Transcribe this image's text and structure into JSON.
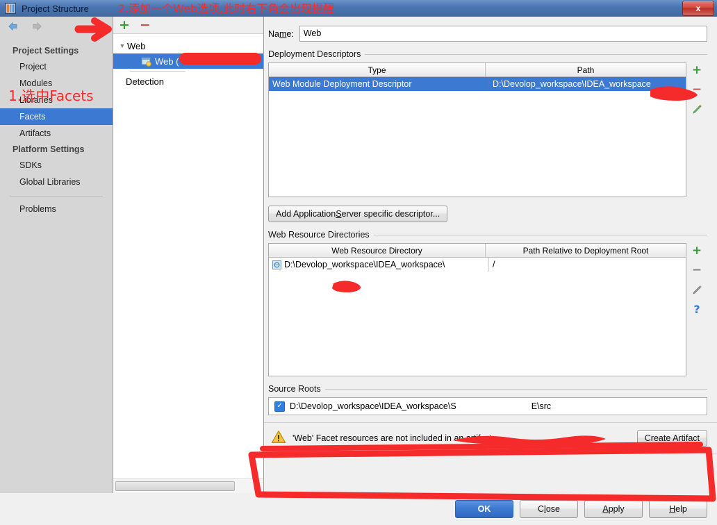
{
  "window": {
    "title": "Project Structure",
    "app_icon": "intellij-idea-icon",
    "close_label": "x"
  },
  "annotations": {
    "title_note": "2.添加一个Web选项,此时右下角会出现提醒",
    "facets_note": "1.选中Facets",
    "color": "#f52a2a"
  },
  "sidebar": {
    "nav": {
      "back_icon": "arrow-left-icon",
      "forward_icon": "arrow-right-icon"
    },
    "groups": [
      {
        "label": "Project Settings",
        "items": [
          {
            "label": "Project",
            "selected": false
          },
          {
            "label": "Modules",
            "selected": false
          },
          {
            "label": "Libraries",
            "selected": false
          },
          {
            "label": "Facets",
            "selected": true
          },
          {
            "label": "Artifacts",
            "selected": false
          }
        ]
      },
      {
        "label": "Platform Settings",
        "items": [
          {
            "label": "SDKs",
            "selected": false
          },
          {
            "label": "Global Libraries",
            "selected": false
          }
        ]
      }
    ],
    "problems_label": "Problems"
  },
  "tree": {
    "toolbar": {
      "add_label": "+",
      "remove_label": "−"
    },
    "root_label": "Web",
    "child_label": "Web (",
    "child_icon": "web-facet-icon",
    "detection_label": "Detection"
  },
  "main": {
    "name_label_pre": "Na",
    "name_label_mnemonic": "m",
    "name_label_post": "e:",
    "name_value": "Web",
    "name_placeholder": "Name",
    "deployment": {
      "section_label": "Deployment Descriptors",
      "columns": [
        "Type",
        "Path"
      ],
      "rows": [
        {
          "type": "Web Module Deployment Descriptor",
          "path": "D:\\Devolop_workspace\\IDEA_workspace",
          "selected": true
        }
      ],
      "tools": [
        "add-icon",
        "remove-icon",
        "edit-icon"
      ]
    },
    "add_descriptor_button": {
      "pre": "Add Application ",
      "mnemonic": "S",
      "post": "erver specific descriptor..."
    },
    "web_resources": {
      "section_label": "Web Resource Directories",
      "columns": [
        "Web Resource Directory",
        "Path Relative to Deployment Root"
      ],
      "rows": [
        {
          "directory": "D:\\Devolop_workspace\\IDEA_workspace\\",
          "relative_path": "/",
          "icon": "folder-web-icon"
        }
      ],
      "tools": [
        "add-icon",
        "remove-icon",
        "edit-icon",
        "help-icon"
      ]
    },
    "source_roots": {
      "section_label": "Source Roots",
      "rows": [
        {
          "checked": true,
          "path_start": "D:\\Devolop_workspace\\IDEA_workspace\\S",
          "path_end": "E\\src"
        }
      ]
    },
    "warning": {
      "icon": "warning-triangle-icon",
      "message": "'Web' Facet resources are not included in an artifact",
      "action_pre": "Create Arti",
      "action_mnemonic": "f",
      "action_post": "act"
    }
  },
  "footer": {
    "ok": "OK",
    "close_pre": "C",
    "close_mnemonic": "l",
    "close_post": "ose",
    "apply_pre": "",
    "apply_mnemonic": "A",
    "apply_post": "pply",
    "help_pre": "",
    "help_mnemonic": "H",
    "help_post": "elp"
  }
}
